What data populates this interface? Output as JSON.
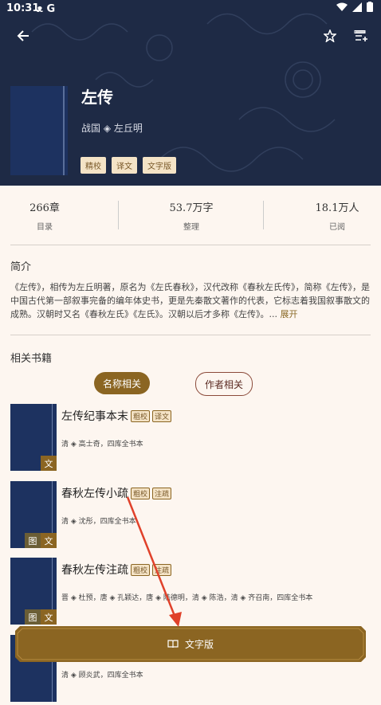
{
  "status": {
    "time": "10:31",
    "icons": [
      "cat-icon",
      "google-icon"
    ],
    "right_icons": [
      "wifi-icon",
      "signal-icon",
      "battery-icon"
    ]
  },
  "toolbar": {
    "back_icon": "arrow-left-icon",
    "star_icon": "star-icon",
    "list_add_icon": "playlist-add-icon"
  },
  "book": {
    "title": "左传",
    "author": "战国 ◈ 左丘明",
    "tags": [
      "精校",
      "译文",
      "文字版"
    ]
  },
  "stats": [
    {
      "value": "266章",
      "label": "目录"
    },
    {
      "value": "53.7万字",
      "label": "整理"
    },
    {
      "value": "18.1万人",
      "label": "已阅"
    }
  ],
  "intro": {
    "heading": "简介",
    "text": "《左传》，相传为左丘明著，原名为《左氏春秋》，汉代改称《春秋左氏传》，简称《左传》，是中国古代第一部叙事完备的编年体史书，更是先秦散文著作的代表，它标志着我国叙事散文的成熟。汉朝时又名《春秋左氏》《左氏》。汉朝以后才多称《左传》。...",
    "more": "展开"
  },
  "related": {
    "heading": "相关书籍",
    "tab_name": "名称相关",
    "tab_author": "作者相关",
    "books": [
      {
        "title": "左传纪事本末",
        "tags": [
          "粗校",
          "译文"
        ],
        "meta": "清 ◈ 高士奇，四库全书本",
        "badges": [
          "文"
        ]
      },
      {
        "title": "春秋左传小疏",
        "tags": [
          "粗校",
          "注疏"
        ],
        "meta": "清 ◈ 沈彤，四库全书本",
        "badges": [
          "图",
          "文"
        ]
      },
      {
        "title": "春秋左传注疏",
        "tags": [
          "粗校",
          "注疏"
        ],
        "meta": "晋 ◈ 杜预，唐 ◈ 孔颖达，唐 ◈ 陆德明，清 ◈ 陈浩，清 ◈ 齐召南，四库全书本",
        "badges": [
          "图",
          "文"
        ]
      },
      {
        "title": "",
        "tags": [],
        "meta": "清 ◈ 顾炎武，四库全书本",
        "badges": []
      }
    ]
  },
  "cta": {
    "label": "文字版",
    "icon": "open-book-icon"
  },
  "colors": {
    "header": "#1e2a45",
    "accent": "#8b6522",
    "background": "#fdf6f0",
    "arrow": "#e0412a"
  }
}
